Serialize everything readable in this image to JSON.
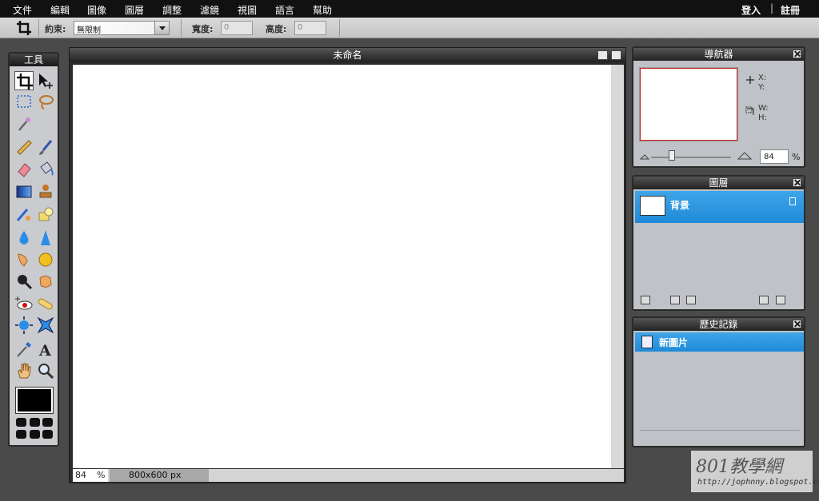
{
  "menubar": {
    "items": [
      "文件",
      "編輯",
      "圖像",
      "圖層",
      "調整",
      "濾鏡",
      "視圖",
      "語言",
      "幫助"
    ],
    "login": "登入",
    "separator": "|",
    "register": "註冊"
  },
  "options": {
    "constraint_label": "約束:",
    "constraint_value": "無限制",
    "width_label": "寬度:",
    "width_value": "0",
    "height_label": "高度:",
    "height_value": "0"
  },
  "tools": {
    "title": "工具",
    "icons": [
      "crop-icon",
      "move-icon",
      "marquee-select-icon",
      "lasso-icon",
      "magic-wand-icon",
      "pencil-icon",
      "brush-icon",
      "eraser-icon",
      "paint-bucket-icon",
      "gradient-icon",
      "clone-stamp-icon",
      "color-replace-icon",
      "drawing-icon",
      "blur-icon",
      "sharpen-icon",
      "smudge-icon",
      "sponge-icon",
      "dodge-icon",
      "burn-icon",
      "red-eye-icon",
      "spot-heal-icon",
      "bloat-icon",
      "pinch-icon",
      "color-picker-icon",
      "type-icon",
      "hand-icon",
      "zoom-icon"
    ],
    "foreground_color": "#000000"
  },
  "canvas": {
    "title": "未命名",
    "zoom": "84",
    "zoom_unit": "%",
    "dimensions": "800x600 px"
  },
  "navigator": {
    "title": "導航器",
    "x_label": "X:",
    "y_label": "Y:",
    "w_label": "W:",
    "h_label": "H:",
    "zoom": "84",
    "zoom_unit": "%"
  },
  "layers": {
    "title": "圖層",
    "items": [
      {
        "name": "背景"
      }
    ]
  },
  "history": {
    "title": "歷史記錄",
    "items": [
      {
        "name": "新圖片"
      }
    ]
  },
  "watermark": {
    "main": "801教學網",
    "url": "http://jophnny.blogspot.com/"
  },
  "colors": {
    "selection_blue": "#2b97e0",
    "panel_gray": "#bfc2c6",
    "background": "#4a4a4a"
  }
}
